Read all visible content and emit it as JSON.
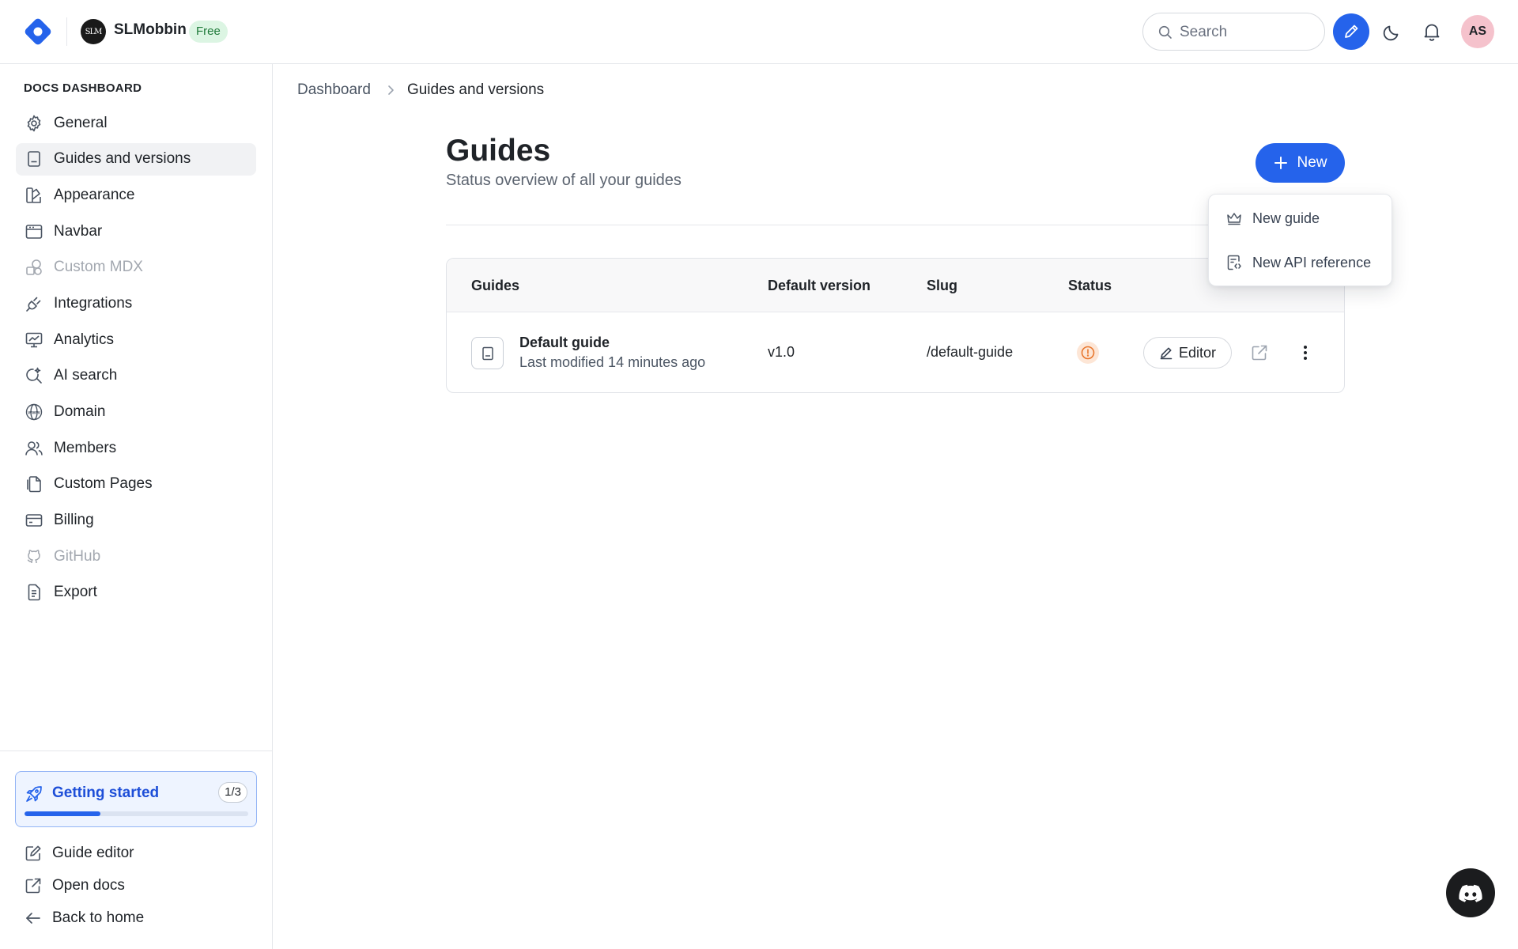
{
  "app": {
    "org_name": "SLMobbin",
    "org_avatar_text": "SLM",
    "plan_badge": "Free",
    "user_initials": "AS",
    "accent_color": "#2563eb"
  },
  "search": {
    "placeholder": "Search",
    "value": ""
  },
  "sidebar": {
    "heading": "DOCS DASHBOARD",
    "items": [
      {
        "label": "General",
        "icon": "gear-icon",
        "state": "default"
      },
      {
        "label": "Guides and versions",
        "icon": "book-icon",
        "state": "active"
      },
      {
        "label": "Appearance",
        "icon": "palette-icon",
        "state": "default"
      },
      {
        "label": "Navbar",
        "icon": "window-icon",
        "state": "default"
      },
      {
        "label": "Custom MDX",
        "icon": "shapes-icon",
        "state": "disabled"
      },
      {
        "label": "Integrations",
        "icon": "plug-icon",
        "state": "default"
      },
      {
        "label": "Analytics",
        "icon": "presentation-chart-icon",
        "state": "default"
      },
      {
        "label": "AI search",
        "icon": "sparkle-search-icon",
        "state": "default"
      },
      {
        "label": "Domain",
        "icon": "globe-www-icon",
        "state": "default"
      },
      {
        "label": "Members",
        "icon": "users-icon",
        "state": "default"
      },
      {
        "label": "Custom Pages",
        "icon": "pages-icon",
        "state": "default"
      },
      {
        "label": "Billing",
        "icon": "credit-card-icon",
        "state": "default"
      },
      {
        "label": "GitHub",
        "icon": "github-icon",
        "state": "disabled"
      },
      {
        "label": "Export",
        "icon": "file-export-icon",
        "state": "default"
      }
    ],
    "getting_started": {
      "label": "Getting started",
      "count": "1/3",
      "progress": 0.34
    },
    "links": [
      {
        "label": "Guide editor",
        "icon": "edit-square-icon"
      },
      {
        "label": "Open docs",
        "icon": "external-link-icon"
      },
      {
        "label": "Back to home",
        "icon": "arrow-left-icon"
      }
    ]
  },
  "breadcrumb": [
    "Dashboard",
    "Guides and versions"
  ],
  "page": {
    "title": "Guides",
    "subtitle": "Status overview of all your guides",
    "new_button": "New"
  },
  "dropdown": {
    "items": [
      {
        "label": "New guide",
        "icon": "crown-icon"
      },
      {
        "label": "New API reference",
        "icon": "api-file-icon"
      }
    ]
  },
  "table": {
    "headers": [
      "Guides",
      "Default version",
      "Slug",
      "Status"
    ],
    "rows": [
      {
        "name": "Default guide",
        "modified": "Last modified 14 minutes ago",
        "version": "v1.0",
        "slug": "/default-guide",
        "status": "warning",
        "status_color": "#e8772e",
        "editor_label": "Editor"
      }
    ]
  }
}
